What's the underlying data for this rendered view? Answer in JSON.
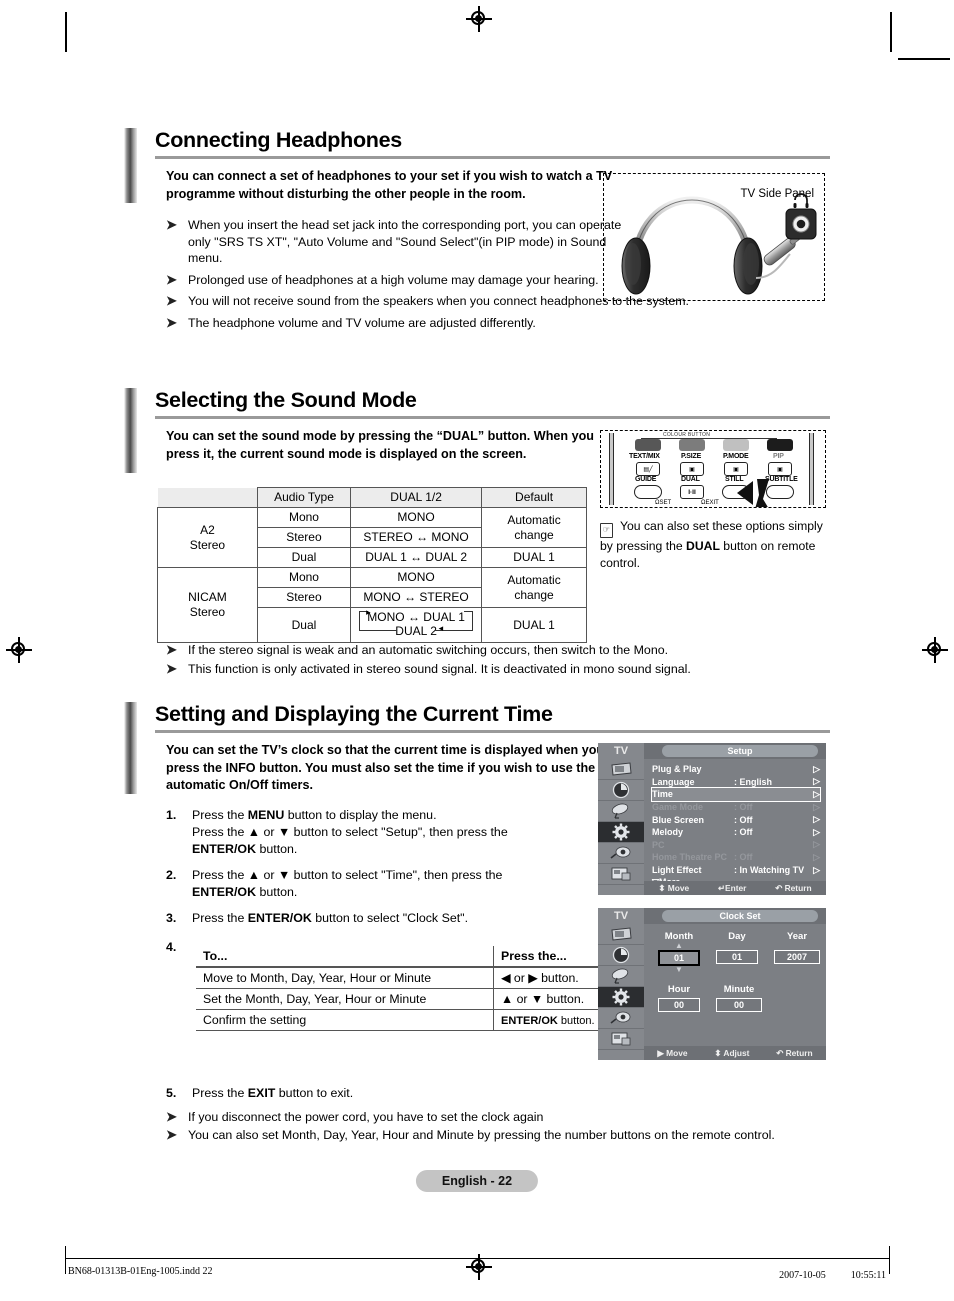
{
  "sections": [
    {
      "id": "headphones",
      "title": "Connecting Headphones",
      "intro": "You can connect a set of headphones to your set if you wish to watch a TV programme without disturbing the other people in the room.",
      "notes": [
        "When you insert the head set jack into the corresponding port, you can operate only \"SRS TS XT\", \"Auto Volume  and \"Sound Select\"(in PIP mode)  in Sound menu.",
        "Prolonged use of headphones at a high volume may damage your hearing.",
        "You will not receive sound from the speakers when you connect headphones to the system.",
        "The headphone volume and TV volume  are adjusted differently."
      ],
      "figure_caption": "TV Side Panel"
    },
    {
      "id": "soundmode",
      "title": "Selecting the Sound Mode",
      "intro": "You can set the sound mode by pressing the “DUAL” button. When you press it, the current sound mode is displayed on the screen.",
      "notes": [
        "If the stereo signal is weak and an automatic switching occurs, then switch to the Mono.",
        "This function is only activated in stereo sound signal. It is deactivated in mono sound signal."
      ]
    },
    {
      "id": "time",
      "title": "Setting and Displaying the Current Time",
      "intro": "You can set the TV’s clock so that the current time is displayed when you press the INFO button. You must also set the time if you wish to use the automatic On/Off timers.",
      "notes": [
        "If you disconnect the power cord, you have to set the clock again",
        "You can also set Month, Day, Year, Hour and Minute by pressing the number buttons on the remote control."
      ]
    }
  ],
  "sound_table": {
    "headers": [
      "",
      "Audio Type",
      "DUAL 1/2",
      "Default"
    ],
    "groups": [
      {
        "name_line1": "A2",
        "name_line2": "Stereo",
        "rows": [
          {
            "audio_type": "Mono",
            "dual": "MONO",
            "default": "Automatic change"
          },
          {
            "audio_type": "Stereo",
            "dual": "STEREO ↔ MONO",
            "default": ""
          },
          {
            "audio_type": "Dual",
            "dual": "DUAL 1 ↔ DUAL 2",
            "default": "DUAL 1"
          }
        ]
      },
      {
        "name_line1": "NICAM",
        "name_line2": "Stereo",
        "rows": [
          {
            "audio_type": "Mono",
            "dual": "MONO",
            "default": "Automatic change"
          },
          {
            "audio_type": "Stereo",
            "dual": "MONO ↔ STEREO",
            "default": ""
          },
          {
            "audio_type": "Dual",
            "dual_line1": "MONO ↔ DUAL 1",
            "dual_line2": "DUAL 2",
            "default": "DUAL 1"
          }
        ]
      }
    ]
  },
  "remote": {
    "group_label": "COLOUR BUTTON",
    "top_labels": [
      "TEXT/MIX",
      "P.SIZE",
      "P.MODE",
      "PIP"
    ],
    "mid_labels": [
      "GUIDE",
      "DUAL",
      "STILL",
      "SUBTITLE"
    ],
    "bottom_labels": [
      "SET",
      "EXIT"
    ],
    "dual_glyph": "I·II",
    "note_prefix": "You can also set these options simply by pressing the ",
    "note_bold": "DUAL",
    "note_suffix": " button on remote control.",
    "note_icon": "note-icon"
  },
  "steps": [
    {
      "num": "1.",
      "parts": [
        {
          "t": "Press the "
        },
        {
          "t": "MENU",
          "b": true
        },
        {
          "t": " button to display the menu."
        },
        {
          "br": true
        },
        {
          "t": "Press the ▲ or ▼ button to select \"Setup\", then press the "
        },
        {
          "br": true
        },
        {
          "t": "ENTER/OK",
          "b": true
        },
        {
          "t": " button."
        }
      ]
    },
    {
      "num": "2.",
      "parts": [
        {
          "t": "Press the ▲ or ▼ button to select \"Time\", then press the "
        },
        {
          "br": true
        },
        {
          "t": "ENTER/OK",
          "b": true
        },
        {
          "t": " button."
        }
      ]
    },
    {
      "num": "3.",
      "parts": [
        {
          "t": "Press the "
        },
        {
          "t": "ENTER/OK",
          "b": true
        },
        {
          "t": " button to select \"Clock Set\"."
        }
      ]
    },
    {
      "num": "4.",
      "parts": []
    },
    {
      "num": "5.",
      "parts": [
        {
          "t": "Press the "
        },
        {
          "t": "EXIT",
          "b": true
        },
        {
          "t": " button to exit."
        }
      ]
    }
  ],
  "key_table": {
    "headers": [
      "To...",
      "Press the..."
    ],
    "rows": [
      {
        "to": "Move to Month, Day, Year, Hour or Minute",
        "press": "◀ or ▶ button.",
        "press_bold": false
      },
      {
        "to": "Set the Month, Day, Year, Hour or Minute",
        "press": "▲ or ▼ button.",
        "press_bold": false
      },
      {
        "to": "Confirm the setting",
        "press_key": "ENTER/OK",
        "press": " button.",
        "press_bold": true
      }
    ]
  },
  "osd_setup": {
    "tv_label": "TV",
    "title": "Setup",
    "rows": [
      {
        "label": "Plug & Play",
        "value": "",
        "arrow": "▷",
        "dim": false,
        "selected": false
      },
      {
        "label": "Language",
        "value": ": English",
        "arrow": "▷",
        "dim": false,
        "selected": false
      },
      {
        "label": "Time",
        "value": "",
        "arrow": "▷",
        "dim": false,
        "selected": true
      },
      {
        "label": "Game Mode",
        "value": ": Off",
        "arrow": "▷",
        "dim": true,
        "selected": false
      },
      {
        "label": "Blue Screen",
        "value": ": Off",
        "arrow": "▷",
        "dim": false,
        "selected": false
      },
      {
        "label": "Melody",
        "value": ": Off",
        "arrow": "▷",
        "dim": false,
        "selected": false
      },
      {
        "label": "PC",
        "value": "",
        "arrow": "▷",
        "dim": true,
        "selected": false
      },
      {
        "label": "Home Theatre PC",
        "value": ": Off",
        "arrow": "▷",
        "dim": true,
        "selected": false
      },
      {
        "label": "Light Effect",
        "value": ": In Watching TV",
        "arrow": "▷",
        "dim": false,
        "selected": false
      },
      {
        "label": "▽More",
        "value": "",
        "arrow": "",
        "dim": false,
        "selected": false
      }
    ],
    "footer": [
      "⬍ Move",
      "↵Enter",
      "↶ Return"
    ],
    "sidebar_icons": [
      "picture-icon",
      "sound-icon",
      "channel-icon",
      "setup-icon",
      "input-icon",
      "pip-icon"
    ],
    "sidebar_selected_index": 3
  },
  "osd_clock": {
    "tv_label": "TV",
    "title": "Clock Set",
    "fields_row1": [
      {
        "label": "Month",
        "value": "01",
        "selected": true
      },
      {
        "label": "Day",
        "value": "01",
        "selected": false
      },
      {
        "label": "Year",
        "value": "2007",
        "selected": false
      }
    ],
    "fields_row2": [
      {
        "label": "Hour",
        "value": "00",
        "selected": false
      },
      {
        "label": "Minute",
        "value": "00",
        "selected": false
      }
    ],
    "footer": [
      "▶ Move",
      "⬍ Adjust",
      "↶ Return"
    ],
    "sidebar_icons": [
      "picture-icon",
      "sound-icon",
      "channel-icon",
      "setup-icon",
      "input-icon",
      "pip-icon"
    ],
    "sidebar_selected_index": 3
  },
  "page_chip": "English - 22",
  "print_footer": {
    "left": "BN68-01313B-01Eng-1005.indd   22",
    "right": "2007-10-05   　　 10:55:11"
  }
}
